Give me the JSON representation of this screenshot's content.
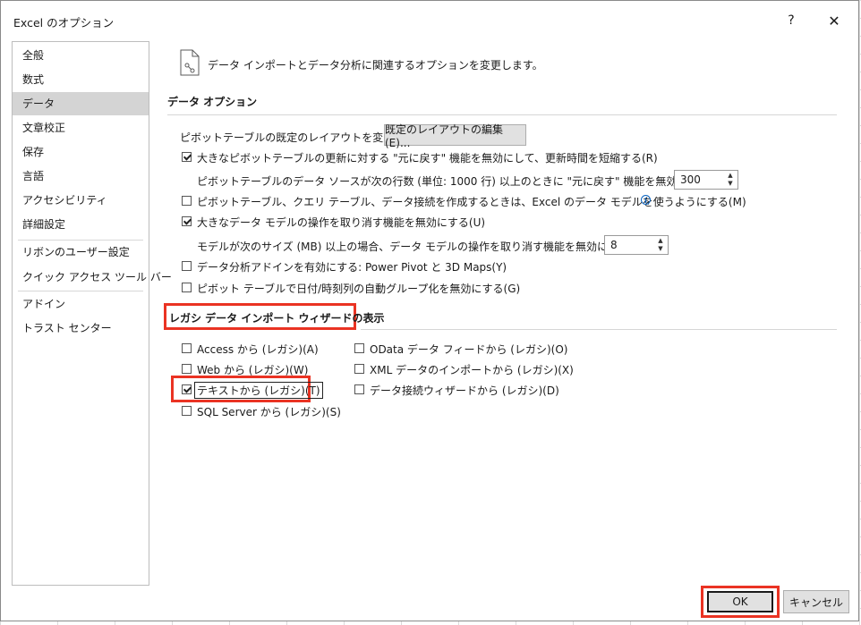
{
  "dialog": {
    "title": "Excel のオプション",
    "help": "?",
    "close": "✕"
  },
  "sidebar": {
    "items": [
      {
        "label": "全般"
      },
      {
        "label": "数式"
      },
      {
        "label": "データ",
        "selected": true
      },
      {
        "label": "文章校正"
      },
      {
        "label": "保存"
      },
      {
        "label": "言語"
      },
      {
        "label": "アクセシビリティ"
      },
      {
        "label": "詳細設定"
      },
      {
        "label": "リボンのユーザー設定"
      },
      {
        "label": "クイック アクセス ツール バー"
      },
      {
        "label": "アドイン"
      },
      {
        "label": "トラスト センター"
      }
    ]
  },
  "header": {
    "description": "データ インポートとデータ分析に関連するオプションを変更します。",
    "icon": "data-document-icon"
  },
  "data_options": {
    "title": "データ オプション",
    "layout_label": "ピボットテーブルの既定のレイアウトを変更する:",
    "layout_button": "既定のレイアウトの編集(E)...",
    "undo_large_pivot": {
      "label": "大きなピボットテーブルの更新に対する \"元に戻す\" 機能を無効にして、更新時間を短縮する(R)",
      "checked": true
    },
    "undo_rows_label": "ピボットテーブルのデータ ソースが次の行数 (単位: 1000 行) 以上のときに \"元に戻す\" 機能を無効にする(N):",
    "undo_rows_value": "300",
    "use_data_model": {
      "label": "ピボットテーブル、クエリ テーブル、データ接続を作成するときは、Excel のデータ モデルを使うようにする(M)",
      "checked": false
    },
    "undo_large_model": {
      "label": "大きなデータ モデルの操作を取り消す機能を無効にする(U)",
      "checked": true
    },
    "model_size_label": "モデルが次のサイズ (MB) 以上の場合、データ モデルの操作を取り消す機能を無効にする(L):",
    "model_size_value": "8",
    "enable_addins": {
      "label": "データ分析アドインを有効にする: Power Pivot と 3D Maps(Y)",
      "checked": false
    },
    "disable_autogroup": {
      "label": "ピボット テーブルで日付/時刻列の自動グループ化を無効にする(G)",
      "checked": false
    }
  },
  "legacy": {
    "title": "レガシ データ インポート ウィザードの表示",
    "left": [
      {
        "label": "Access から (レガシ)(A)",
        "checked": false
      },
      {
        "label": "Web から (レガシ)(W)",
        "checked": false
      },
      {
        "label": "テキストから (レガシ)(T)",
        "checked": true
      },
      {
        "label": "SQL Server から (レガシ)(S)",
        "checked": false
      }
    ],
    "right": [
      {
        "label": "OData データ フィードから (レガシ)(O)",
        "checked": false
      },
      {
        "label": "XML データのインポートから (レガシ)(X)",
        "checked": false
      },
      {
        "label": "データ接続ウィザードから (レガシ)(D)",
        "checked": false
      }
    ]
  },
  "footer": {
    "ok": "OK",
    "cancel": "キャンセル"
  },
  "colors": {
    "highlight": "#ea3323",
    "selected_nav": "#d4d4d4",
    "info": "#0b64c0"
  }
}
